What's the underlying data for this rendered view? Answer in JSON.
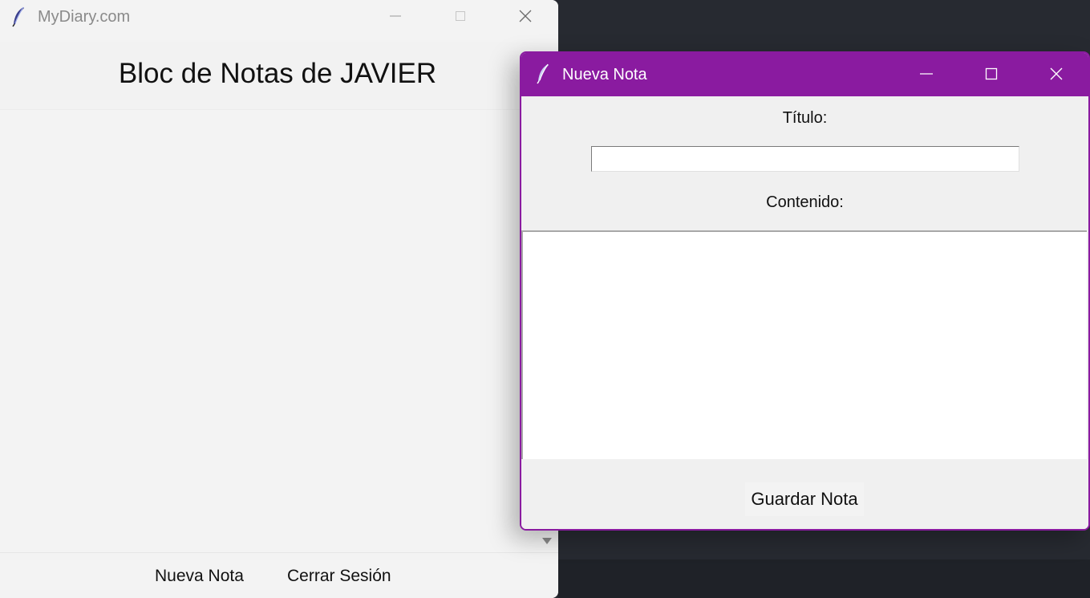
{
  "main_window": {
    "title": "MyDiary.com",
    "heading": "Bloc de Notas de JAVIER",
    "footer": {
      "new_note_label": "Nueva Nota",
      "logout_label": "Cerrar Sesión"
    }
  },
  "dialog": {
    "title": "Nueva Nota",
    "title_field_label": "Título:",
    "title_field_value": "",
    "content_field_label": "Contenido:",
    "content_field_value": "",
    "save_label": "Guardar Nota"
  },
  "colors": {
    "dialog_accent": "#8a1ba0",
    "window_background": "#f3f3f3",
    "desktop_background": "#272a31"
  },
  "icons": {
    "app_icon": "feather-icon",
    "minimize": "minimize-icon",
    "maximize": "maximize-icon",
    "close": "close-icon",
    "scroll_down": "triangle-down-icon"
  }
}
